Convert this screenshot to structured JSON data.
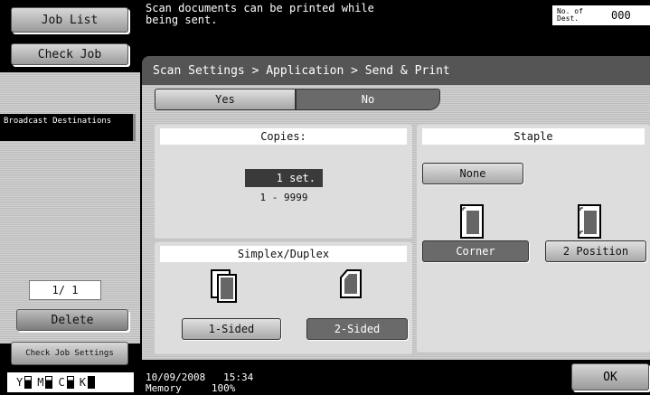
{
  "left": {
    "job_list": "Job List",
    "check_job": "Check Job",
    "broadcast_destinations": "Broadcast Destinations",
    "page_counter": "1/ 1",
    "delete": "Delete",
    "check_job_settings": "Check Job Settings",
    "toner": [
      "Y",
      "M",
      "C",
      "K"
    ]
  },
  "header": {
    "message": "Scan documents can be printed while\nbeing sent.",
    "dest_label": "No. of\nDest.",
    "dest_value": "000"
  },
  "breadcrumb": "Scan Settings > Application > Send & Print",
  "toggle": {
    "yes": "Yes",
    "no": "No",
    "selected": "No"
  },
  "copies": {
    "title": "Copies:",
    "value": "1 set.",
    "range": "1 - 9999"
  },
  "simplex": {
    "title": "Simplex/Duplex",
    "one_sided": "1-Sided",
    "two_sided": "2-Sided",
    "selected": "2-Sided"
  },
  "staple": {
    "title": "Staple",
    "none": "None",
    "corner": "Corner",
    "two_position": "2 Position",
    "selected": "Corner"
  },
  "status": {
    "date": "10/09/2008",
    "time": "15:34",
    "memory_label": "Memory",
    "memory_value": "100%"
  },
  "ok": "OK"
}
